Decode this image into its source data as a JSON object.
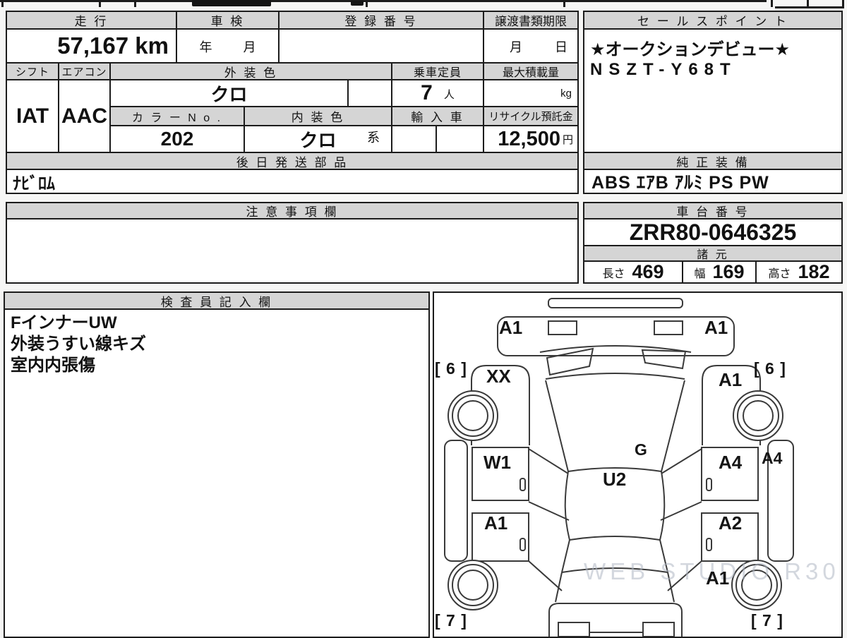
{
  "main": {
    "mileage_label": "走 行",
    "mileage_value": "57,167 km",
    "shaken_label": "車 検",
    "shaken_year": "年",
    "shaken_month": "月",
    "registration_label": "登 録 番 号",
    "registration_value": "",
    "deadline_label": "譲渡書類期限",
    "deadline_month": "月",
    "deadline_day": "日",
    "shift_label": "シフト",
    "shift_value": "IAT",
    "aircon_label": "エアコン",
    "aircon_value": "AAC",
    "ext_color_label": "外 装 色",
    "ext_color_value": "クロ",
    "capacity_label": "乗車定員",
    "capacity_value": "7",
    "capacity_unit": "人",
    "max_load_label": "最大積載量",
    "max_load_unit": "kg",
    "color_no_label": "カ ラ ー N o .",
    "color_no_value": "202",
    "int_color_label": "内 装 色",
    "int_color_value": "クロ",
    "int_color_suffix": "系",
    "import_label": "輸 入 車",
    "recycle_label": "リサイクル預託金",
    "recycle_value": "12,500",
    "recycle_unit": "円",
    "later_parts_label": "後 日 発 送 部 品",
    "later_parts_value": "ﾅﾋﾞﾛﾑ",
    "sales_label": "セ ー ル ス ポ イ ン ト",
    "sales_line1": "★オークションデビュー★",
    "sales_line2": "NSZT-Y68T",
    "equipment_label": "純 正 装 備",
    "equipment_value": "ABS ｴｱB ｱﾙﾐ PS PW"
  },
  "notes": {
    "label": "注 意 事 項 欄",
    "value": ""
  },
  "chassis": {
    "label": "車 台 番 号",
    "value": "ZRR80-0646325"
  },
  "specs": {
    "label": "諸 元",
    "items": [
      {
        "k": "長さ",
        "v": "469"
      },
      {
        "k": "幅",
        "v": "169"
      },
      {
        "k": "高さ",
        "v": "182"
      }
    ]
  },
  "inspector": {
    "label": "検 査 員 記 入 欄",
    "lines": [
      "FインナーUW",
      "外装うすい線キズ",
      "室内内張傷"
    ]
  },
  "diagram": {
    "watermark": "WEB STUDIO R30",
    "labels": [
      {
        "text": "A1"
      },
      {
        "text": "A1"
      },
      {
        "text": "[ 6 ]"
      },
      {
        "text": "XX"
      },
      {
        "text": "A1"
      },
      {
        "text": "[ 6 ]"
      },
      {
        "text": "W1"
      },
      {
        "text": "G"
      },
      {
        "text": "U2"
      },
      {
        "text": "A4"
      },
      {
        "text": "A4"
      },
      {
        "text": "A1"
      },
      {
        "text": "A2"
      },
      {
        "text": "A1"
      },
      {
        "text": "[ 7 ]"
      },
      {
        "text": "[ 7 ]"
      }
    ]
  }
}
